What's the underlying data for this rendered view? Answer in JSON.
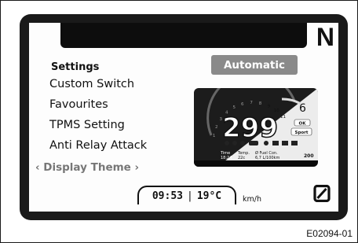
{
  "display": {
    "gear": "N",
    "settings_title": "Settings",
    "menu": [
      {
        "label": "Custom Switch"
      },
      {
        "label": "Favourites"
      },
      {
        "label": "TPMS Setting"
      },
      {
        "label": "Anti Relay Attack"
      },
      {
        "label": "‹ Display Theme ›",
        "selected": true
      }
    ],
    "mode_button": "Automatic",
    "status": {
      "time": "09:53",
      "temp": "19°C",
      "speed_unit": "km/h"
    },
    "preview": {
      "speed": "299",
      "gear": "6",
      "rpm_ticks": [
        "1",
        "2",
        "3",
        "4",
        "5",
        "6",
        "7",
        "8",
        "9",
        "10",
        "11"
      ],
      "badge_ok": "OK",
      "badge_mode": "Sport",
      "info_labels": [
        "Time",
        "Temp.",
        "Ø Fuel Con."
      ],
      "info_values": [
        "18:24",
        "22c",
        "6,7 L/100km"
      ],
      "odo": "200"
    },
    "icon_names": [
      "zero-state-icon"
    ]
  },
  "figure_code": "E02094-01"
}
